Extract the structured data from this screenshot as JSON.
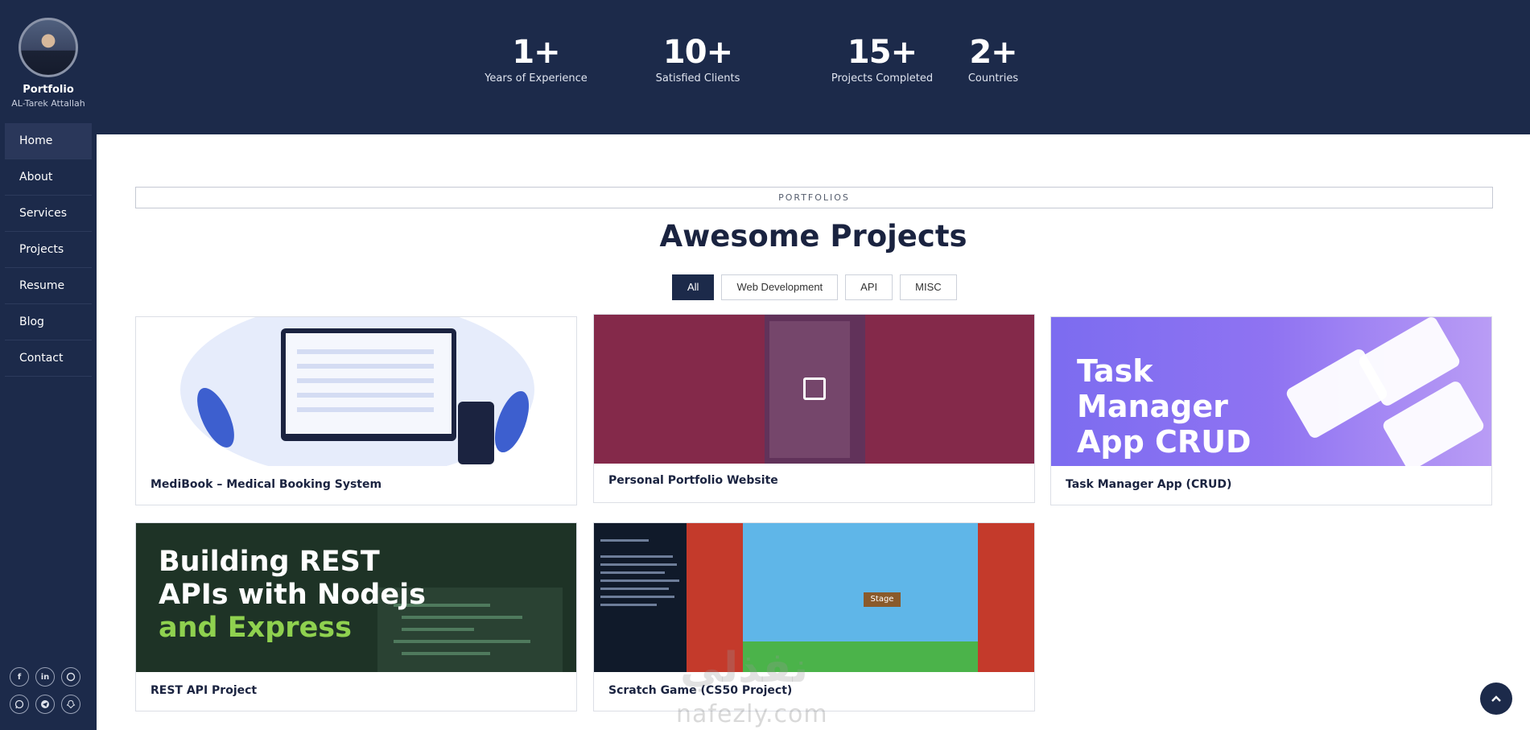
{
  "profile": {
    "name": "Portfolio",
    "subtitle": "AL-Tarek Attallah"
  },
  "nav": [
    {
      "label": "Home",
      "active": true
    },
    {
      "label": "About"
    },
    {
      "label": "Services"
    },
    {
      "label": "Projects"
    },
    {
      "label": "Resume"
    },
    {
      "label": "Blog"
    },
    {
      "label": "Contact"
    }
  ],
  "socials": [
    "facebook-icon",
    "linkedin-icon",
    "github-icon",
    "whatsapp-icon",
    "telegram-icon",
    "snapchat-icon"
  ],
  "stats": [
    {
      "value": "1+",
      "label": "Years of Experience"
    },
    {
      "value": "10+",
      "label": "Satisfied Clients"
    },
    {
      "value": "15+",
      "label": "Projects Completed"
    },
    {
      "value": "2+",
      "label": "Countries"
    }
  ],
  "section": {
    "tag": "PORTFOLIOS",
    "title": "Awesome Projects"
  },
  "filters": [
    {
      "label": "All",
      "active": true
    },
    {
      "label": "Web Development"
    },
    {
      "label": "API"
    },
    {
      "label": "MISC"
    }
  ],
  "projects": [
    {
      "title": "MediBook – Medical Booking System"
    },
    {
      "title": "Personal Portfolio Website"
    },
    {
      "title": "Task Manager App (CRUD)",
      "image_text": "Task Manager App CRUD"
    },
    {
      "title": "REST API Project",
      "image_text_1": "Building REST APIs with Nodejs",
      "image_text_2": "and Express"
    },
    {
      "title": "Scratch Game (CS50 Project)",
      "image_text": "Stage"
    }
  ],
  "watermark": {
    "text": "nafezly.com",
    "arabic": "نفذلي"
  },
  "colors": {
    "navy": "#1c2a4a",
    "accent_green": "#8fd14f"
  }
}
